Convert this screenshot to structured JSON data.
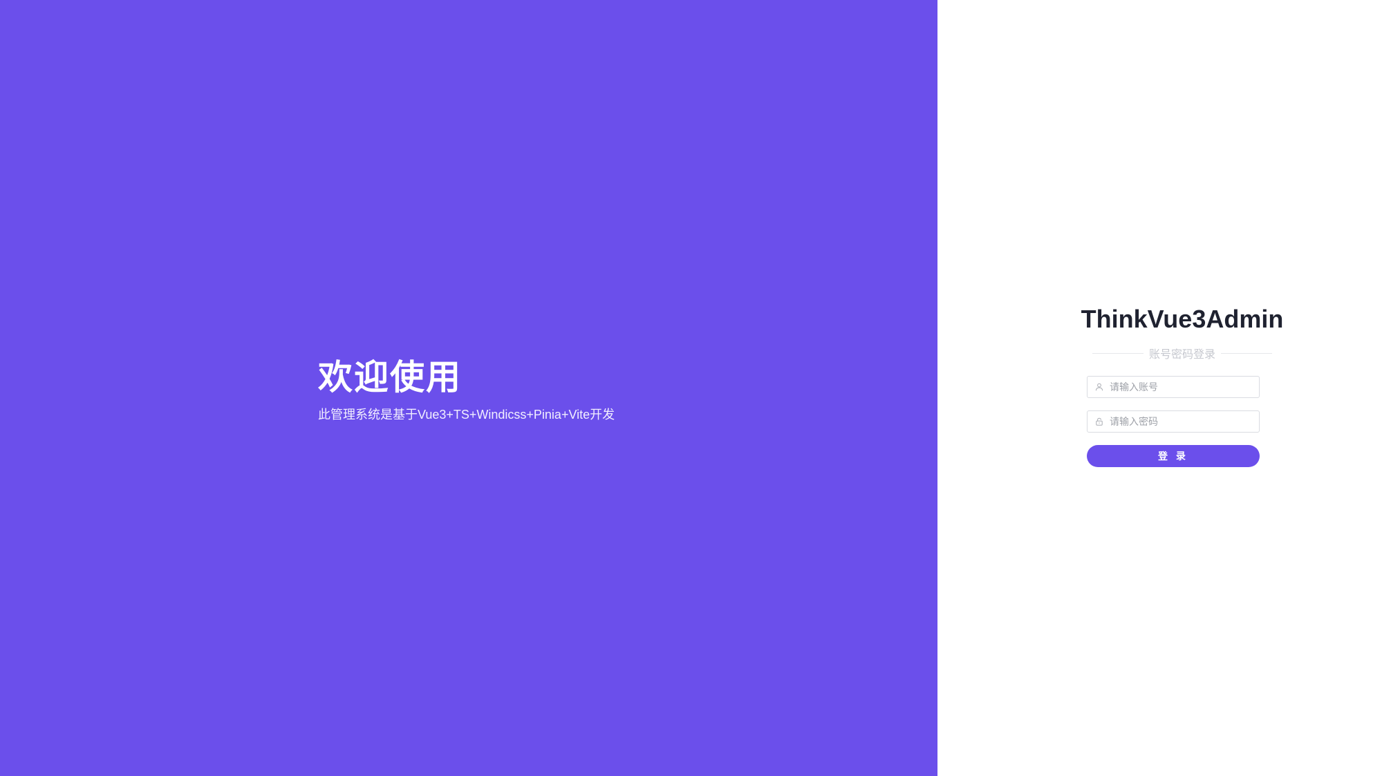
{
  "welcome": {
    "title": "欢迎使用",
    "subtitle": "此管理系统是基于Vue3+TS+Windicss+Pinia+Vite开发"
  },
  "login": {
    "app_title": "ThinkVue3Admin",
    "divider_text": "账号密码登录",
    "account_placeholder": "请输入账号",
    "account_value": "",
    "password_placeholder": "请输入密码",
    "password_value": "",
    "submit_label": "登 录"
  },
  "icons": {
    "account": "user-icon",
    "password": "lock-icon"
  },
  "colors": {
    "brand": "#6b4feb",
    "title_text": "#1f2230",
    "divider_text": "#c6c8cf",
    "placeholder": "#9ea1a8"
  }
}
